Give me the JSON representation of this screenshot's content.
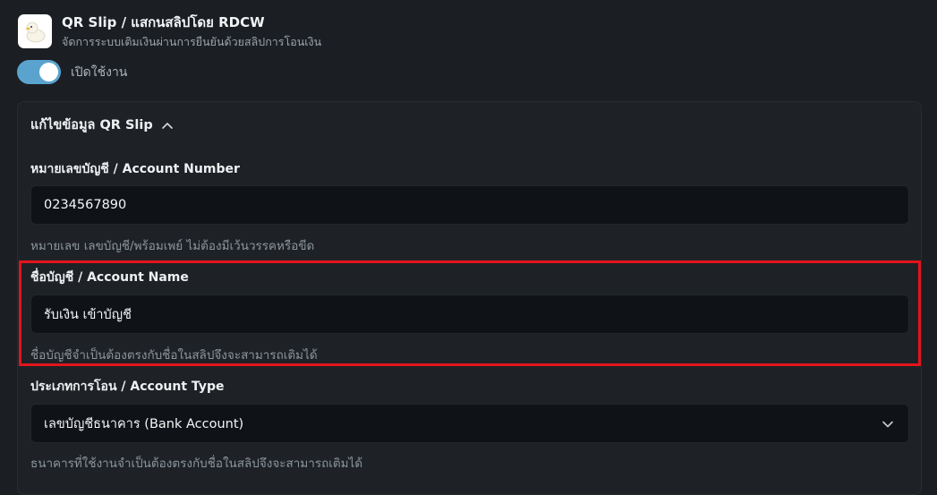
{
  "app": {
    "icon": "duck-icon",
    "title": "QR Slip / แสกนสลิปโดย RDCW",
    "subtitle": "จัดการระบบเติมเงินผ่านการยืนยันด้วยสลิปการโอนเงิน"
  },
  "toggle": {
    "label": "เปิดใช้งาน",
    "enabled": true,
    "color": "#5ba3cf"
  },
  "panel": {
    "title": "แก้ไขข้อมูล QR Slip",
    "fields": {
      "account_number": {
        "label": "หมายเลขบัญชี / Account Number",
        "value": "0234567890",
        "help": "หมายเลข เลขบัญชี/พร้อมเพย์ ไม่ต้องมีเว้นวรรคหรือขีด"
      },
      "account_name": {
        "label": "ชื่อบัญชี / Account Name",
        "value": "รับเงิน เข้าบัญชี",
        "help": "ชื่อบัญชีจำเป็นต้องตรงกับชื่อในสลิปจึงจะสามารถเติมได้"
      },
      "account_type": {
        "label": "ประเภทการโอน / Account Type",
        "value": "เลขบัญชีธนาคาร (Bank Account)",
        "help": "ธนาคารที่ใช้งานจำเป็นต้องตรงกับชื่อในสลิปจึงจะสามารถเติมได้"
      }
    }
  },
  "highlight_color": "#e3141b"
}
